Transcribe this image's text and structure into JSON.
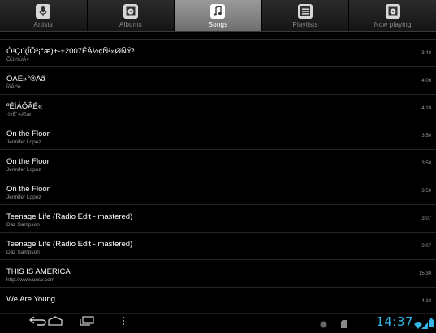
{
  "tabs": [
    {
      "label": "Artists",
      "icon": "microphone-icon",
      "active": false
    },
    {
      "label": "Albums",
      "icon": "album-icon",
      "active": false
    },
    {
      "label": "Songs",
      "icon": "music-note-icon",
      "active": true
    },
    {
      "label": "Playlists",
      "icon": "playlist-icon",
      "active": false
    },
    {
      "label": "Now playing",
      "icon": "now-playing-icon",
      "active": false
    }
  ],
  "songs": [
    {
      "title": "Ò¹Çú(ÎÕ³¡°æ)+-+2007ÊÀ½çÑ²»ØÑÝ³",
      "artist": "ÕÜ½ÙÂ×",
      "duration": "3:48"
    },
    {
      "title": "ÒÀÈ»°®Äã",
      "artist": "ÍõÁ¦ºê",
      "duration": "4:06"
    },
    {
      "title": "ºÉÌÁÔÂÉ«",
      "artist": "·ï»Ë´«Ææ",
      "duration": "4:10"
    },
    {
      "title": "On the Floor",
      "artist": "Jennifer Lopez",
      "duration": "3:50"
    },
    {
      "title": "On the Floor",
      "artist": "Jennifer Lopez",
      "duration": "3:50"
    },
    {
      "title": "On the Floor",
      "artist": "Jennifer Lopez",
      "duration": "3:50"
    },
    {
      "title": "Teenage Life (Radio Edit - mastered)",
      "artist": "Daz Sampson",
      "duration": "3:07"
    },
    {
      "title": "Teenage Life (Radio Edit - mastered)",
      "artist": "Daz Sampson",
      "duration": "3:07"
    },
    {
      "title": "THIS IS AMERICA",
      "artist": "http://www.unsv.com",
      "duration": "15:30"
    },
    {
      "title": "We Are Young",
      "artist": "",
      "duration": "4:10"
    }
  ],
  "system": {
    "clock": "14:37",
    "accent": "#33b5e5"
  }
}
